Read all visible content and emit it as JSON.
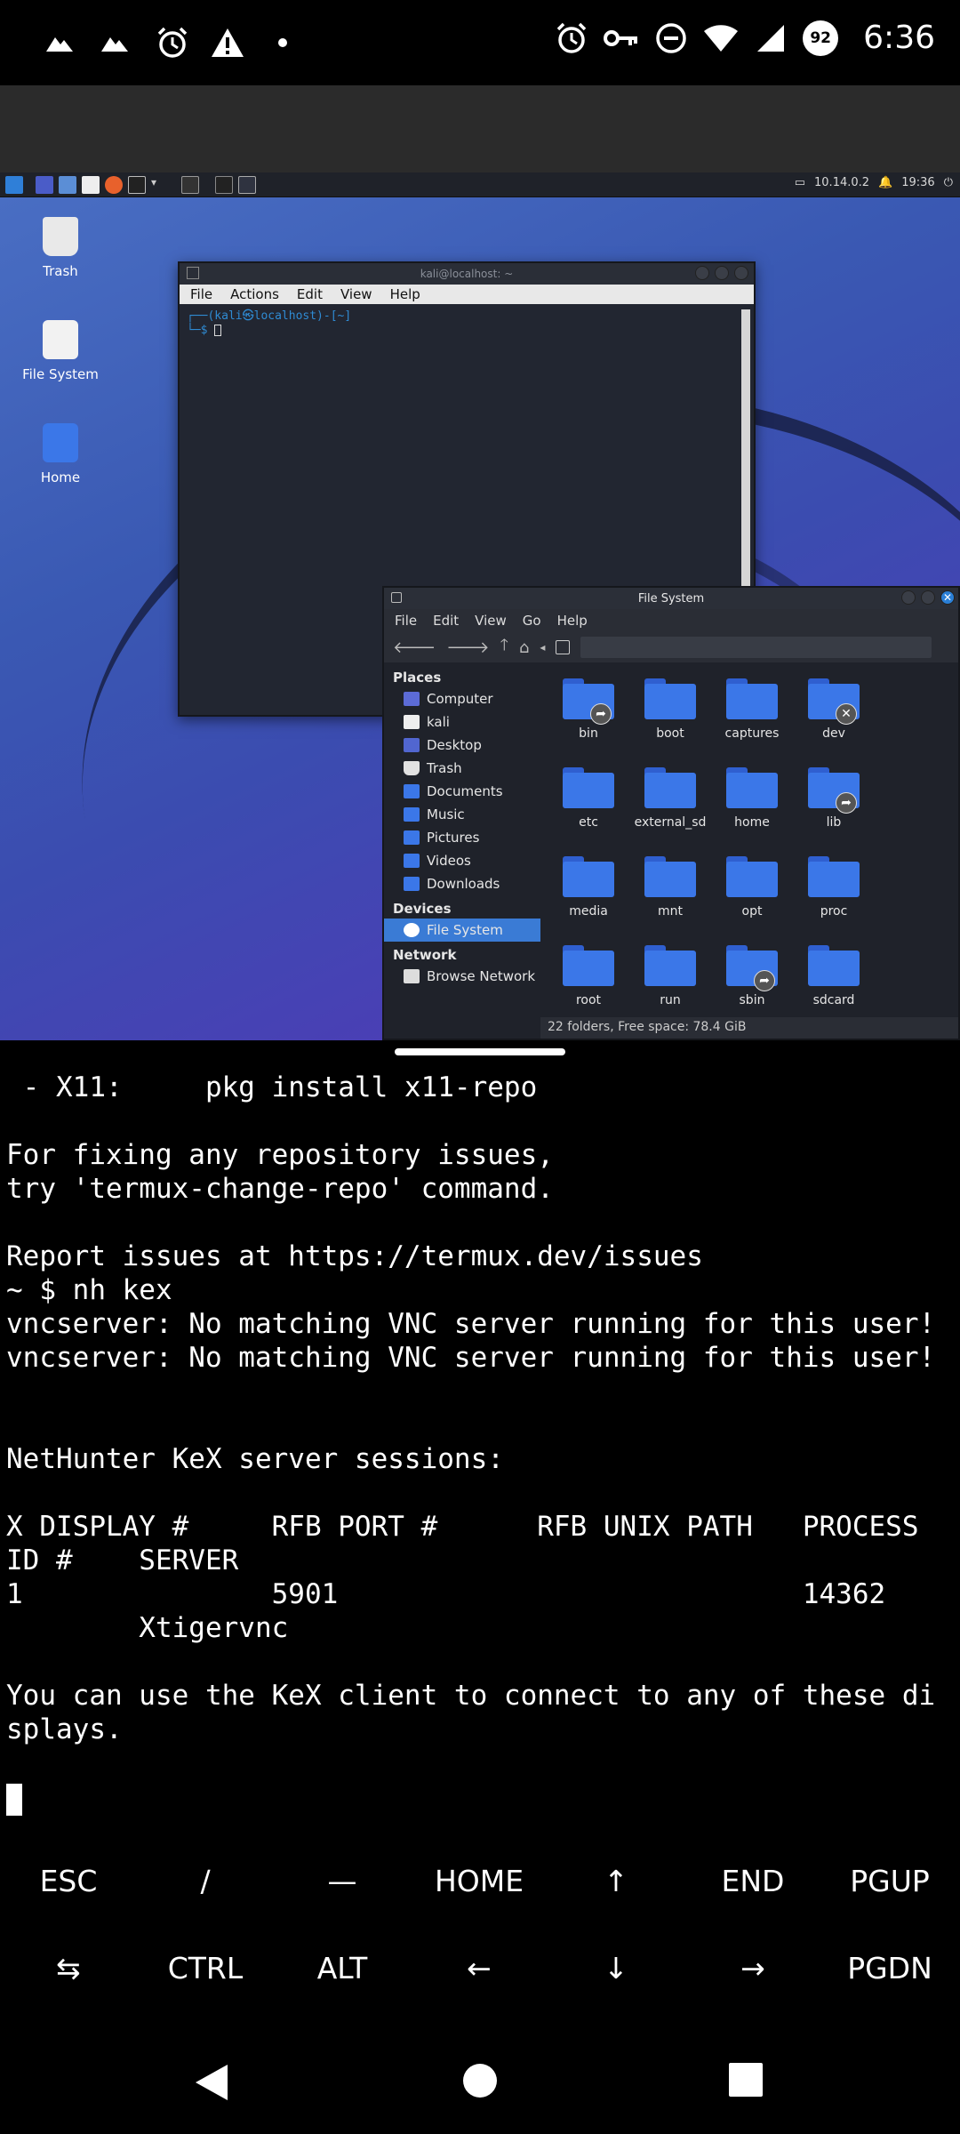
{
  "status_bar": {
    "time": "6:36",
    "battery": "92"
  },
  "vnc": {
    "panel": {
      "ip": "10.14.0.2",
      "time": "19:36"
    },
    "desktop_icons": [
      {
        "label": "Trash"
      },
      {
        "label": "File System"
      },
      {
        "label": "Home"
      }
    ],
    "terminal": {
      "title": "kali@localhost: ~",
      "menus": [
        "File",
        "Actions",
        "Edit",
        "View",
        "Help"
      ],
      "prompt_line1": "┌──(kali㉿localhost)-[~]",
      "prompt_line2": "└─$ "
    },
    "file_manager": {
      "title": "File System",
      "menus": [
        "File",
        "Edit",
        "View",
        "Go",
        "Help"
      ],
      "sidebar": {
        "places_header": "Places",
        "places": [
          "Computer",
          "kali",
          "Desktop",
          "Trash",
          "Documents",
          "Music",
          "Pictures",
          "Videos",
          "Downloads"
        ],
        "devices_header": "Devices",
        "devices": [
          "File System"
        ],
        "network_header": "Network",
        "network": [
          "Browse Network"
        ]
      },
      "folders": [
        "bin",
        "boot",
        "captures",
        "dev",
        "etc",
        "external_sd",
        "home",
        "lib",
        "media",
        "mnt",
        "opt",
        "proc",
        "root",
        "run",
        "sbin",
        "sdcard"
      ],
      "status": "22 folders, Free space: 78.4 GiB"
    }
  },
  "termux": {
    "lines": [
      " - X11:     pkg install x11-repo",
      "",
      "For fixing any repository issues,",
      "try 'termux-change-repo' command.",
      "",
      "Report issues at https://termux.dev/issues",
      "~ $ nh kex",
      "vncserver: No matching VNC server running for this user!",
      "vncserver: No matching VNC server running for this user!",
      "",
      "",
      "NetHunter KeX server sessions:",
      "",
      "X DISPLAY #     RFB PORT #      RFB UNIX PATH   PROCESS",
      "ID #    SERVER",
      "1               5901                            14362",
      "        Xtigervnc",
      "",
      "You can use the KeX client to connect to any of these di",
      "splays."
    ]
  },
  "extra_keys": {
    "row1": [
      "ESC",
      "/",
      "—",
      "HOME",
      "↑",
      "END",
      "PGUP"
    ],
    "row2": [
      "⇆",
      "CTRL",
      "ALT",
      "←",
      "↓",
      "→",
      "PGDN"
    ]
  }
}
